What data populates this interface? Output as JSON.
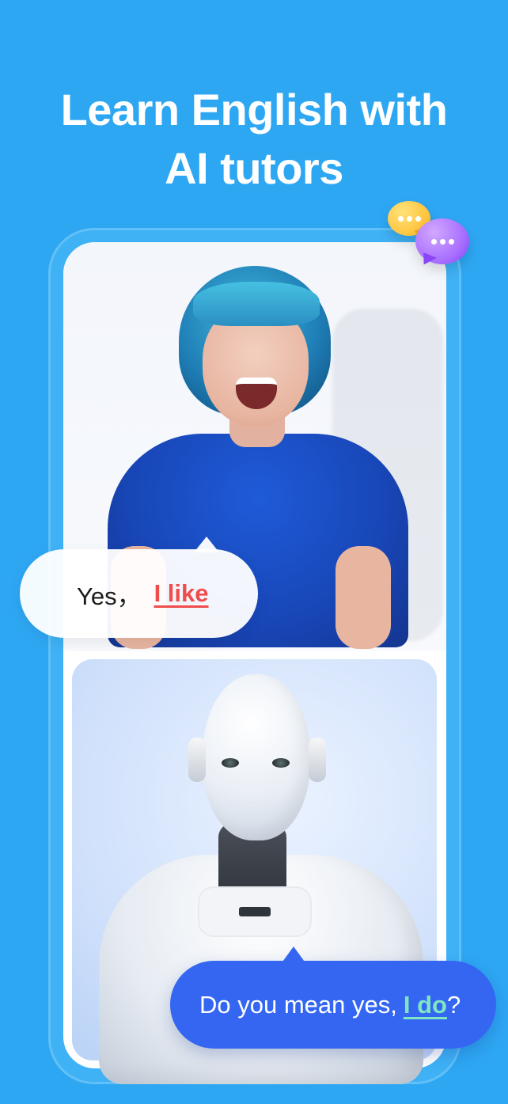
{
  "header": {
    "title_line1": "Learn English with",
    "title_line2": "AI tutors"
  },
  "bubbles": {
    "left": {
      "prefix": "Yes，",
      "highlight": "I like"
    },
    "right": {
      "prefix": "Do you mean yes,",
      "highlight": "I do",
      "suffix": "?"
    }
  },
  "icons": {
    "chat_yellow": "chat-bubble-yellow-icon",
    "chat_purple": "chat-bubble-purple-icon"
  },
  "colors": {
    "background": "#2ea7f3",
    "left_highlight": "#f04c4c",
    "right_bubble": "#3466f2",
    "right_highlight": "#7fe6c3"
  }
}
